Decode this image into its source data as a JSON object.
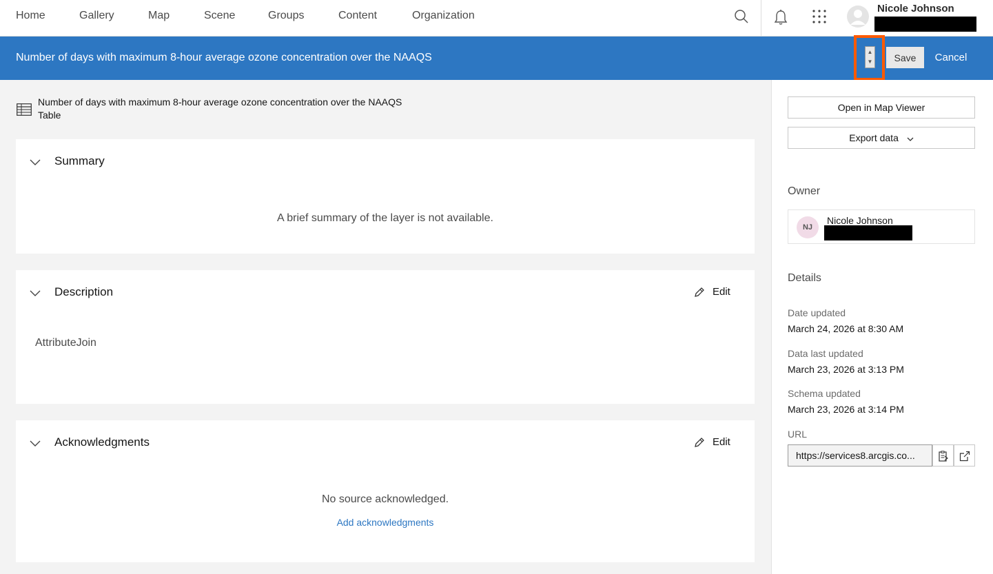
{
  "nav": {
    "links": [
      "Home",
      "Gallery",
      "Map",
      "Scene",
      "Groups",
      "Content",
      "Organization"
    ],
    "user_name": "Nicole Johnson"
  },
  "header": {
    "title": "Number of days with maximum 8-hour average ozone concentration over the NAAQS",
    "save_label": "Save",
    "cancel_label": "Cancel"
  },
  "item": {
    "title": "Number of days with maximum 8-hour average ozone concentration over the NAAQS",
    "type": "Table"
  },
  "summary": {
    "title": "Summary",
    "text": "A brief summary of the layer is not available."
  },
  "description": {
    "title": "Description",
    "edit_label": "Edit",
    "text": "AttributeJoin"
  },
  "acknowledgments": {
    "title": "Acknowledgments",
    "edit_label": "Edit",
    "text": "No source acknowledged.",
    "link_label": "Add acknowledgments"
  },
  "side": {
    "open_map_viewer": "Open in Map Viewer",
    "export_data": "Export data",
    "owner_heading": "Owner",
    "owner_initials": "NJ",
    "owner_name": "Nicole Johnson",
    "details_heading": "Details",
    "details": [
      {
        "label": "Date updated",
        "value": "March 24, 2026 at 8:30 AM"
      },
      {
        "label": "Data last updated",
        "value": "March 23, 2026 at 3:13 PM"
      },
      {
        "label": "Schema updated",
        "value": "March 23, 2026 at 3:14 PM"
      }
    ],
    "url_label": "URL",
    "url_value": "https://services8.arcgis.co..."
  },
  "colors": {
    "header_blue": "#2d77c2",
    "highlight_orange": "#ff5a00",
    "link_blue": "#2d77c2",
    "owner_avatar_bg": "#f1dbe7"
  }
}
